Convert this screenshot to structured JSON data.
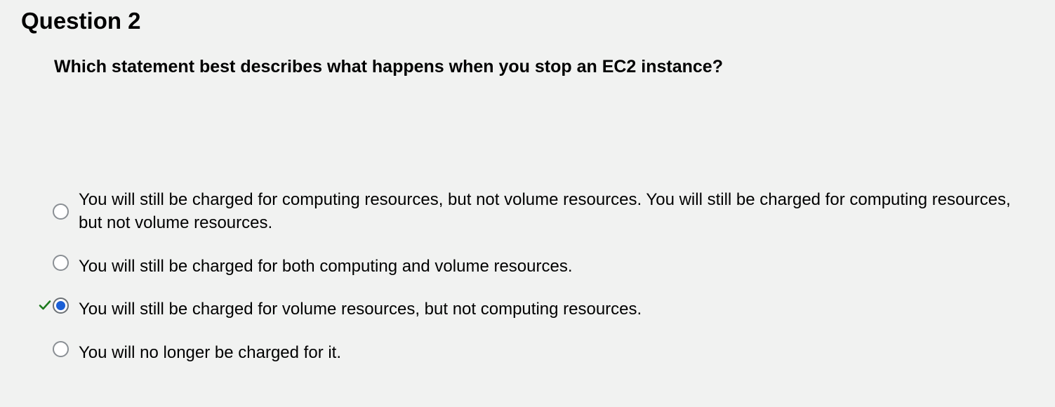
{
  "question": {
    "number_label": "Question 2",
    "text": "Which statement best describes what happens when you stop an EC2 instance?"
  },
  "options": [
    {
      "label": "You will still be charged for computing resources, but not volume resources. You will still be charged for computing resources, but not volume resources.",
      "selected": false,
      "correct_mark": false
    },
    {
      "label": "You will still be charged for both computing and volume resources.",
      "selected": false,
      "correct_mark": false
    },
    {
      "label": "You will still be charged for volume resources, but not computing resources.",
      "selected": true,
      "correct_mark": true
    },
    {
      "label": "You will no longer be charged for it.",
      "selected": false,
      "correct_mark": false
    }
  ],
  "colors": {
    "background": "#f1f2f1",
    "radio_selected_fill": "#1a5fd6",
    "radio_border": "#8a8f94",
    "check_mark": "#1d7a1d"
  }
}
